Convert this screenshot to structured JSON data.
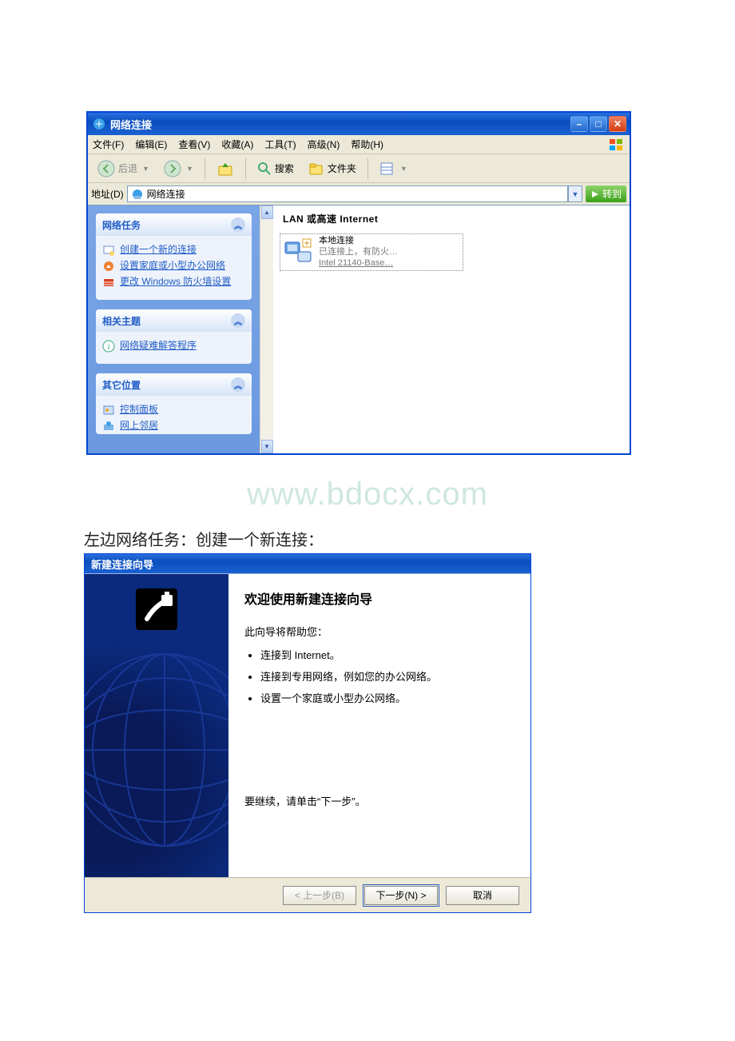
{
  "watermark": "www.bdocx.com",
  "caption": "左边网络任务：创建一个新连接：",
  "window1": {
    "title": "网络连接",
    "menus": {
      "file": "文件(F)",
      "edit": "编辑(E)",
      "view": "查看(V)",
      "fav": "收藏(A)",
      "tools": "工具(T)",
      "adv": "高级(N)",
      "help": "帮助(H)"
    },
    "toolbar": {
      "back": "后退",
      "search": "搜索",
      "folders": "文件夹"
    },
    "address": {
      "label": "地址(D)",
      "value": "网络连接",
      "go": "转到"
    },
    "sidebar": {
      "panel1": {
        "title": "网络任务",
        "items": [
          "创建一个新的连接",
          "设置家庭或小型办公网络",
          "更改 Windows 防火墙设置"
        ]
      },
      "panel2": {
        "title": "相关主题",
        "items": [
          "网络疑难解答程序"
        ]
      },
      "panel3": {
        "title": "其它位置",
        "items": [
          "控制面板",
          "网上邻居"
        ]
      }
    },
    "content": {
      "group": "LAN 或高速 Internet",
      "conn": {
        "name": "本地连接",
        "status": "已连接上，有防火…",
        "device": "Intel 21140-Base…"
      }
    }
  },
  "window2": {
    "title": "新建连接向导",
    "heading": "欢迎使用新建连接向导",
    "lead": "此向导将帮助您：",
    "bullets": [
      "连接到 Internet。",
      "连接到专用网络，例如您的办公网络。",
      "设置一个家庭或小型办公网络。"
    ],
    "continue": "要继续，请单击“下一步”。",
    "buttons": {
      "back": "< 上一步(B)",
      "next": "下一步(N) >",
      "cancel": "取消"
    }
  }
}
